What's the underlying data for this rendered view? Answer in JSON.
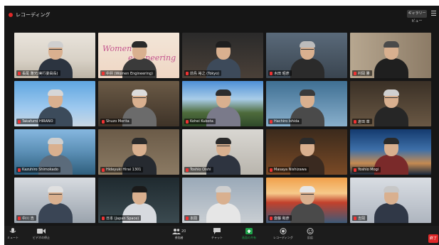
{
  "recording": {
    "label": "レコーディング"
  },
  "view_button": {
    "label": "ギャラリービュー"
  },
  "colors": {
    "accent_red": "#e02828",
    "toolbar_bg": "#1c1c1c",
    "share_green": "#1fa34a"
  },
  "participants": [
    {
      "name": "長尾 雅光(実行委員長)"
    },
    {
      "name": "中井 (Women Engineering)"
    },
    {
      "name": "前島 裕之 (Tokyo)"
    },
    {
      "name": "木田 昭彦"
    },
    {
      "name": "村岡 勝"
    },
    {
      "name": "Takafumi HIRANO"
    },
    {
      "name": "Shuzo Morita"
    },
    {
      "name": "Kohei Kubota"
    },
    {
      "name": "Hachiro Ishida"
    },
    {
      "name": "倉田 章"
    },
    {
      "name": "Kazuhiro Shimokado"
    },
    {
      "name": "Hideyuki Hirai 1301"
    },
    {
      "name": "Toshio Oishi"
    },
    {
      "name": "Masaya Nishizawa"
    },
    {
      "name": "Yoshio Mogi"
    },
    {
      "name": "中川 浩"
    },
    {
      "name": "日本 (Japan Space)"
    },
    {
      "name": "本間"
    },
    {
      "name": "齋藤 和彦"
    },
    {
      "name": "吉岡"
    }
  ],
  "toolbar": {
    "mute": "ミュート",
    "video": "ビデオの停止",
    "participants": "参加者",
    "participants_count": "20",
    "chat": "チャット",
    "share": "画面の共有",
    "record": "レコーディング",
    "reactions": "反応",
    "end": "終了"
  }
}
